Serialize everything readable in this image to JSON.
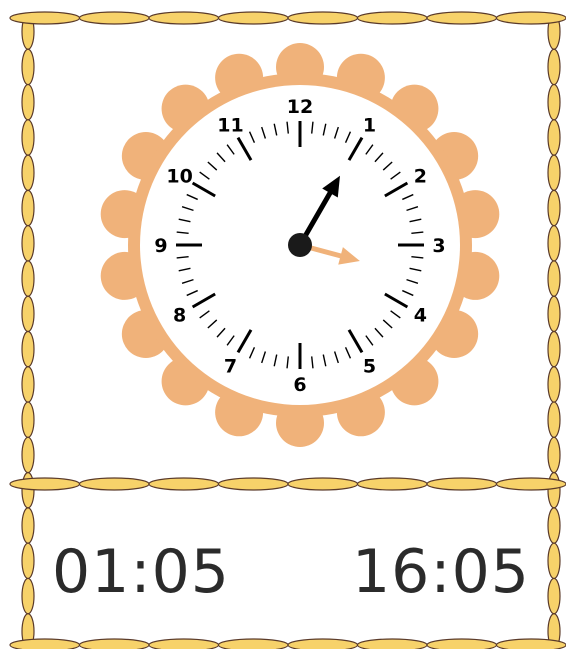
{
  "clock": {
    "numerals": [
      "12",
      "1",
      "2",
      "3",
      "4",
      "5",
      "6",
      "7",
      "8",
      "9",
      "10",
      "11"
    ],
    "hour_hand_points_to": 1,
    "minute_hand_points_to": 3.5,
    "hour_hand_color": "#000000",
    "minute_hand_color": "#f0b27a",
    "scallop_color": "#f0b27a",
    "face_color": "#ffffff"
  },
  "options": {
    "left": "01:05",
    "right": "16:05"
  },
  "border": {
    "fill_color": "#f7d26a",
    "outline_color": "#5a3a2a"
  }
}
